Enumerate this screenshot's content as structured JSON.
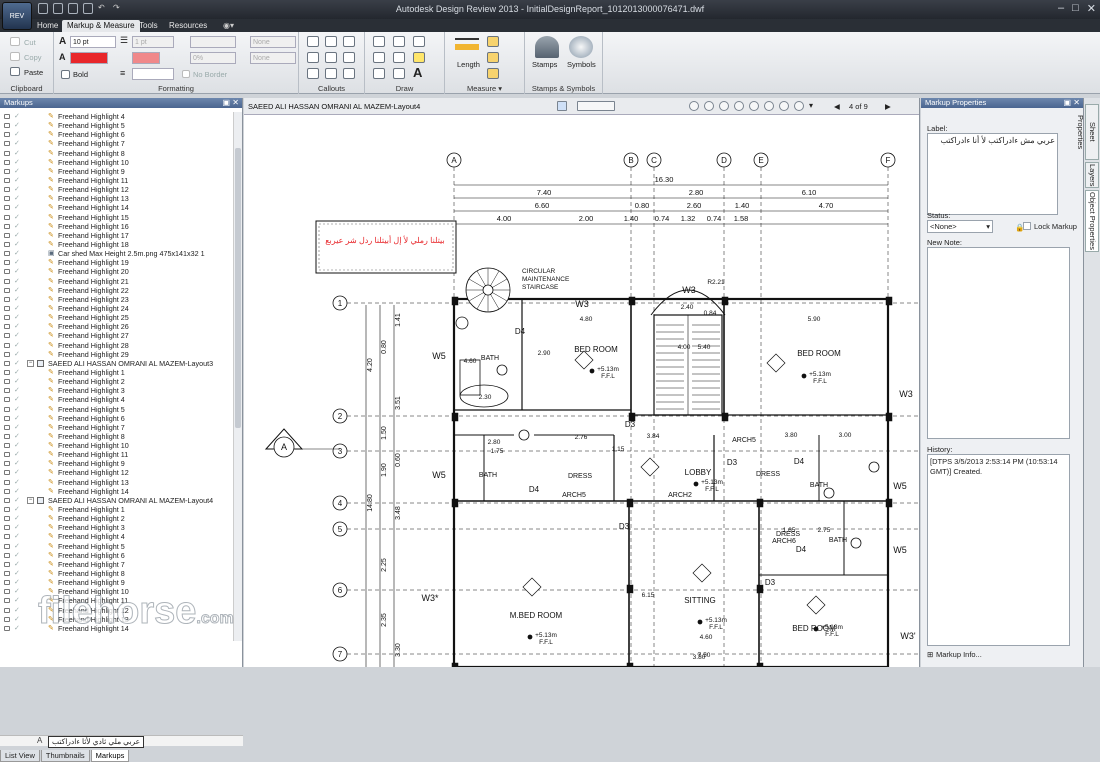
{
  "window": {
    "title": "Autodesk Design Review 2013 - InitialDesignReport_1012013000076471.dwf",
    "app_logo": "REV",
    "controls": [
      "–",
      "□",
      "✕"
    ]
  },
  "ribbon_tabs": [
    "Home",
    "Markup & Measure",
    "Tools",
    "Resources"
  ],
  "ribbon": {
    "clipboard": {
      "cut": "Cut",
      "copy": "Copy",
      "paste": "Paste",
      "label": "Clipboard"
    },
    "formatting": {
      "font_size": "10 pt",
      "bold": "Bold",
      "line_weight": "1 pt",
      "none1": "None",
      "none2": "None",
      "opacity": "0%",
      "no_border": "No Border",
      "label": "Formatting",
      "accent_color": "#e8262a"
    },
    "callouts_label": "Callouts",
    "draw_label": "Draw",
    "measure": {
      "length": "Length",
      "label": "Measure"
    },
    "stamps": {
      "stamps": "Stamps",
      "symbols": "Symbols",
      "label": "Stamps & Symbols"
    }
  },
  "markups_panel": {
    "title": "Markups",
    "rows": [
      {
        "t": "h",
        "l": "Freehand Highlight 4"
      },
      {
        "t": "h",
        "l": "Freehand Highlight 5"
      },
      {
        "t": "h",
        "l": "Freehand Highlight 6"
      },
      {
        "t": "h",
        "l": "Freehand Highlight 7"
      },
      {
        "t": "h",
        "l": "Freehand Highlight 8"
      },
      {
        "t": "h",
        "l": "Freehand Highlight 10"
      },
      {
        "t": "h",
        "l": "Freehand Highlight 9"
      },
      {
        "t": "h",
        "l": "Freehand Highlight 11"
      },
      {
        "t": "h",
        "l": "Freehand Highlight 12"
      },
      {
        "t": "h",
        "l": "Freehand Highlight 13"
      },
      {
        "t": "h",
        "l": "Freehand Highlight 14"
      },
      {
        "t": "h",
        "l": "Freehand Highlight 15"
      },
      {
        "t": "h",
        "l": "Freehand Highlight 16"
      },
      {
        "t": "h",
        "l": "Freehand Highlight 17"
      },
      {
        "t": "h",
        "l": "Freehand Highlight 18"
      },
      {
        "t": "f",
        "l": "Car shed Max Height 2.5m.png 475x141x32 1"
      },
      {
        "t": "h",
        "l": "Freehand Highlight 19"
      },
      {
        "t": "h",
        "l": "Freehand Highlight 20"
      },
      {
        "t": "h",
        "l": "Freehand Highlight 21"
      },
      {
        "t": "h",
        "l": "Freehand Highlight 22"
      },
      {
        "t": "h",
        "l": "Freehand Highlight 23"
      },
      {
        "t": "h",
        "l": "Freehand Highlight 24"
      },
      {
        "t": "h",
        "l": "Freehand Highlight 25"
      },
      {
        "t": "h",
        "l": "Freehand Highlight 26"
      },
      {
        "t": "h",
        "l": "Freehand Highlight 27"
      },
      {
        "t": "h",
        "l": "Freehand Highlight 28"
      },
      {
        "t": "h",
        "l": "Freehand Highlight 29"
      },
      {
        "t": "d",
        "l": "SAEED ALI HASSAN OMRANI AL MAZEM-Layout3"
      },
      {
        "t": "h",
        "l": "Freehand Highlight 1"
      },
      {
        "t": "h",
        "l": "Freehand Highlight 2"
      },
      {
        "t": "h",
        "l": "Freehand Highlight 3"
      },
      {
        "t": "h",
        "l": "Freehand Highlight 4"
      },
      {
        "t": "h",
        "l": "Freehand Highlight 5"
      },
      {
        "t": "h",
        "l": "Freehand Highlight 6"
      },
      {
        "t": "h",
        "l": "Freehand Highlight 7"
      },
      {
        "t": "h",
        "l": "Freehand Highlight 8"
      },
      {
        "t": "h",
        "l": "Freehand Highlight 10"
      },
      {
        "t": "h",
        "l": "Freehand Highlight 11"
      },
      {
        "t": "h",
        "l": "Freehand Highlight 9"
      },
      {
        "t": "h",
        "l": "Freehand Highlight 12"
      },
      {
        "t": "h",
        "l": "Freehand Highlight 13"
      },
      {
        "t": "h",
        "l": "Freehand Highlight 14"
      },
      {
        "t": "d",
        "l": "SAEED ALI HASSAN OMRANI AL MAZEM-Layout4"
      },
      {
        "t": "h",
        "l": "Freehand Highlight 1"
      },
      {
        "t": "h",
        "l": "Freehand Highlight 2"
      },
      {
        "t": "h",
        "l": "Freehand Highlight 3"
      },
      {
        "t": "h",
        "l": "Freehand Highlight 4"
      },
      {
        "t": "h",
        "l": "Freehand Highlight 5"
      },
      {
        "t": "h",
        "l": "Freehand Highlight 6"
      },
      {
        "t": "h",
        "l": "Freehand Highlight 7"
      },
      {
        "t": "h",
        "l": "Freehand Highlight 8"
      },
      {
        "t": "h",
        "l": "Freehand Highlight 9"
      },
      {
        "t": "h",
        "l": "Freehand Highlight 10"
      },
      {
        "t": "h",
        "l": "Freehand Highlight 11"
      },
      {
        "t": "h",
        "l": "Freehand Highlight 12"
      },
      {
        "t": "h",
        "l": "Freehand Highlight 13"
      },
      {
        "t": "h",
        "l": "Freehand Highlight 14"
      }
    ],
    "arabic_item": "عربي ملي ثادي لأثا ءادراكتب",
    "bottom_tabs": [
      "List View",
      "Thumbnails",
      "Markups"
    ]
  },
  "drawing": {
    "sheet_title": "SAEED ALI HASSAN OMRANI AL MAZEM-Layout4",
    "page": "4 of 9",
    "markup_text": "بيتلنا رملي لأ إل أبيتلنا ردل شر عيربع",
    "grid_cols": [
      "A",
      "B",
      "C",
      "D",
      "E",
      "F"
    ],
    "grid_rows": [
      "1",
      "2",
      "3",
      "4",
      "5",
      "6",
      "7"
    ],
    "dims": {
      "top_total": "16.30",
      "row1": [
        "7.40",
        "2.80",
        "6.10"
      ],
      "row2": [
        "6.60",
        "0.80",
        "2.60",
        "1.40",
        "4.70"
      ],
      "row3": [
        "4.00",
        "2.00",
        "1.40",
        "0.74",
        "1.32",
        "0.74",
        "1.58"
      ],
      "left": [
        "4.20",
        "0.80",
        "1.41",
        "3.51",
        "1.50",
        "0.60",
        "1.90",
        "14.80",
        "3.48",
        "2.25",
        "2.35",
        "3.30"
      ]
    },
    "rooms": {
      "bed1": "BED ROOM",
      "bed2": "BED ROOM",
      "bed3": "BED ROOM",
      "mbed": "M.BED ROOM",
      "sitting": "SITTING",
      "lobby": "LOBBY",
      "bath": "BATH",
      "dress": "DRESS",
      "ffl": "+5.13m",
      "ffl2": "F.F.L",
      "stair": "CIRCULAR MAINTENANCE STAIRCASE"
    },
    "tags": {
      "w3": "W3",
      "w5": "W5",
      "d3": "D3",
      "d4": "D4",
      "w3s": "W3*",
      "w3p": "W3'",
      "arch5": "ARCH5",
      "arch2": "ARCH2",
      "arch6": "ARCH6"
    },
    "section_marker": "A",
    "misc_dims": [
      "4.80",
      "5.90",
      "2.40",
      "2.30",
      "2.80",
      "2.76",
      "3.84",
      "3.80",
      "3.00",
      "1.65",
      "2.75",
      "4.60",
      "6.15",
      "7.50",
      "4.60",
      "2.90",
      "4.00",
      "5.40",
      "1.15",
      "1.75",
      "3.80",
      "0.84",
      "R2.21"
    ]
  },
  "properties": {
    "title": "Markup Properties",
    "label_caption": "Label:",
    "label_value": "عربي مش ءادراكتب لأ أنا ءادراكتب",
    "status_caption": "Status:",
    "status_value": "<None>",
    "lock_markup": "Lock Markup",
    "new_note": "New Note:",
    "history_caption": "History:",
    "history_value": "[DTPS 3/5/2013 2:53:14 PM (10:53:14 GMT)] Created.",
    "markup_info": "Markup Info..."
  },
  "side_tabs": [
    "Sheet Properties",
    "Layers",
    "Object Properties"
  ],
  "watermark": "filehorse",
  "watermark_tld": ".com"
}
